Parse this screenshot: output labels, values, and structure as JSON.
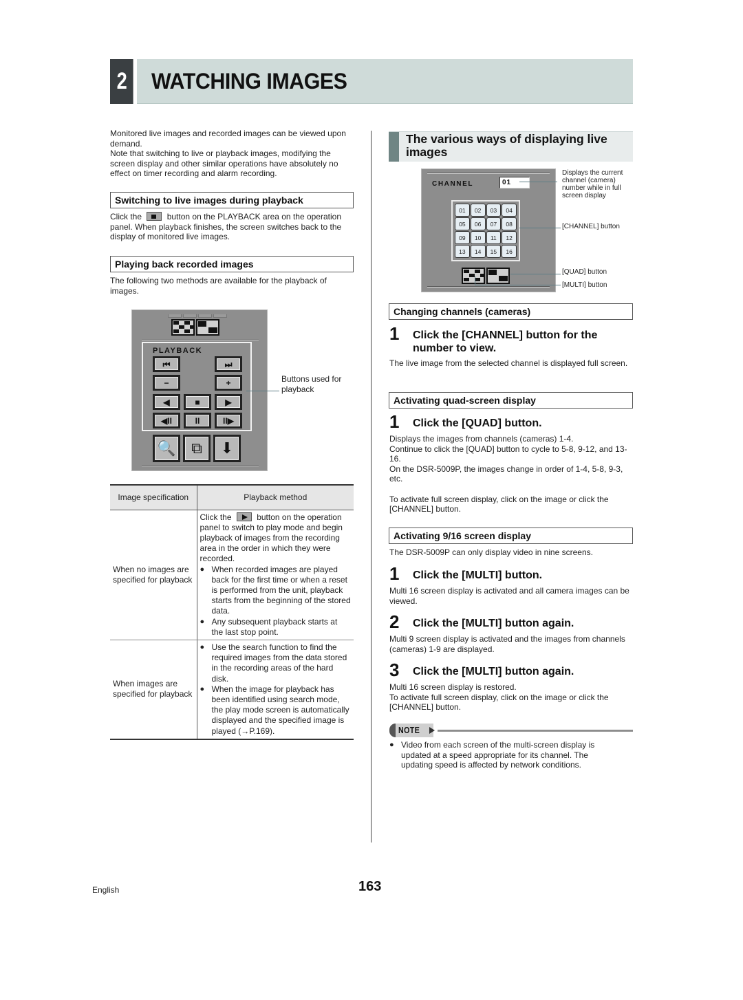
{
  "chapter": {
    "number": "2",
    "title": "WATCHING IMAGES"
  },
  "intro": {
    "para1": "Monitored live images and recorded images can be viewed upon demand.",
    "para2": "Note that switching to live or playback images, modifying the screen display and other similar operations have absolutely no effect on timer recording and alarm recording."
  },
  "switching": {
    "heading": "Switching to live images during playback",
    "text_before": "Click the",
    "inline_icon": "stop-button-icon",
    "text_after": "button on the PLAYBACK area on the operation panel. When playback finishes, the screen switches back to the display of monitored live images."
  },
  "playing_back": {
    "heading": "Playing back recorded images",
    "text": "The following two methods are available for the playback of images."
  },
  "playback_panel": {
    "label": "PLAYBACK",
    "callout": "Buttons used for playback",
    "buttons": [
      {
        "name": "skip-to-start",
        "glyph": "⏮"
      },
      {
        "name": "skip-to-end",
        "glyph": "⏭"
      },
      {
        "name": "minus",
        "glyph": "−"
      },
      {
        "name": "plus",
        "glyph": "+"
      },
      {
        "name": "reverse",
        "glyph": "◀"
      },
      {
        "name": "stop",
        "glyph": "■"
      },
      {
        "name": "play",
        "glyph": "▶"
      },
      {
        "name": "step-back",
        "glyph": "◀II"
      },
      {
        "name": "pause",
        "glyph": "II"
      },
      {
        "name": "step-forward",
        "glyph": "II▶"
      }
    ],
    "bottom_buttons": [
      {
        "name": "search",
        "glyph": "🔍"
      },
      {
        "name": "copy",
        "glyph": "⧉"
      },
      {
        "name": "download",
        "glyph": "⬇"
      }
    ]
  },
  "table": {
    "headers": [
      "Image specification",
      "Playback method"
    ],
    "rows": [
      {
        "spec": "When no images are specified for playback",
        "intro_before": "Click the",
        "inline_icon": "play-button-icon",
        "intro_after": "button on the operation panel to switch to play mode and begin playback of images from the recording area in the order in which they were recorded.",
        "bullets": [
          "When recorded images are played back for the first time or when a reset is performed from the unit, playback starts from the beginning of the stored data.",
          "Any subsequent playback starts at the last stop point."
        ]
      },
      {
        "spec": "When images are specified for playback",
        "bullets": [
          "Use the search function to find the required images from the data stored in the recording areas of the hard disk.",
          "When the image for playback has been identified using search mode, the play mode screen is automatically displayed and the specified image is played (→P.169)."
        ]
      }
    ]
  },
  "right": {
    "section_title": "The various ways of displaying live images",
    "channel_panel": {
      "label": "CHANNEL",
      "current_channel": "01",
      "channels": [
        "01",
        "02",
        "03",
        "04",
        "05",
        "06",
        "07",
        "08",
        "09",
        "10",
        "11",
        "12",
        "13",
        "14",
        "15",
        "16"
      ],
      "callouts": {
        "display": "Displays the current channel (camera) number while in full screen display",
        "channel_button": "[CHANNEL] button",
        "quad_button": "[QUAD] button",
        "multi_button": "[MULTI] button"
      }
    },
    "changing": {
      "heading": "Changing channels (cameras)",
      "step_num": "1",
      "step_title": "Click the [CHANNEL] button for the number to view.",
      "text": "The live image from the selected channel is displayed full screen."
    },
    "quad": {
      "heading": "Activating quad-screen display",
      "step_num": "1",
      "step_title": "Click the [QUAD] button.",
      "text1": "Displays the images from channels (cameras) 1-4.",
      "text2": "Continue to click the [QUAD] button to cycle to 5-8, 9-12, and 13-16.",
      "text3": "On the DSR-5009P, the images change in order of 1-4, 5-8, 9-3, etc.",
      "text4": "To activate full screen display, click on the image or click the [CHANNEL] button."
    },
    "multi": {
      "heading": "Activating 9/16 screen display",
      "text": "The DSR-5009P can only display video in nine screens.",
      "steps": [
        {
          "num": "1",
          "title": "Click the [MULTI] button.",
          "text": "Multi 16 screen display is activated and all camera images can be viewed."
        },
        {
          "num": "2",
          "title": "Click the [MULTI] button again.",
          "text": "Multi 9 screen display is activated and the images from channels (cameras) 1-9 are displayed."
        },
        {
          "num": "3",
          "title": "Click the [MULTI] button again.",
          "text": "Multi 16 screen display is restored.",
          "text2": "To activate full screen display, click on the image or click the [CHANNEL] button."
        }
      ]
    },
    "note": {
      "label": "NOTE",
      "bullets": [
        "Video from each screen of the multi-screen display is updated at a speed appropriate for its channel. The updating speed is affected by network conditions."
      ]
    }
  },
  "footer": {
    "language": "English",
    "page_number": "163"
  },
  "colors": {
    "chapter_bar": "#cfdbd9",
    "chapter_num_bg": "#3a3f42",
    "section_accent": "#6f8584",
    "panel_gray": "#8e8e8e",
    "channel_cell": "#e6eef3"
  }
}
